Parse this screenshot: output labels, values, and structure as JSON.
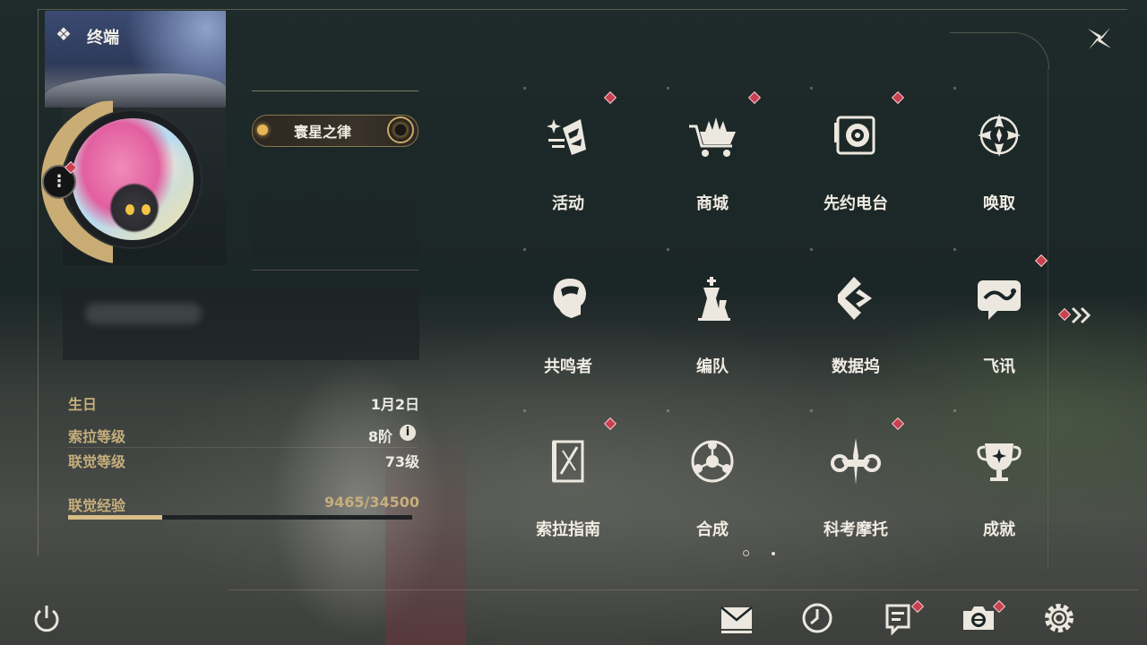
{
  "header": {
    "title": "终端"
  },
  "profile": {
    "title_badge": "寰星之律",
    "stats": [
      {
        "label": "生日",
        "value": "1月2日"
      },
      {
        "label": "索拉等级",
        "value": "8阶"
      },
      {
        "label": "联觉等级",
        "value": "73级"
      }
    ],
    "experience": {
      "label": "联觉经验",
      "value": "9465/34500",
      "current": 9465,
      "max": 34500
    }
  },
  "menu": {
    "items": [
      {
        "label": "活动",
        "icon": "activity-icon",
        "badge": true
      },
      {
        "label": "商城",
        "icon": "shop-cart-icon",
        "badge": true
      },
      {
        "label": "先约电台",
        "icon": "radio-icon",
        "badge": true
      },
      {
        "label": "唤取",
        "icon": "compass-star-icon",
        "badge": false
      },
      {
        "label": "共鸣者",
        "icon": "resonator-head-icon",
        "badge": false
      },
      {
        "label": "编队",
        "icon": "chess-team-icon",
        "badge": false
      },
      {
        "label": "数据坞",
        "icon": "data-dock-icon",
        "badge": false
      },
      {
        "label": "飞讯",
        "icon": "chat-icon",
        "badge": true
      },
      {
        "label": "索拉指南",
        "icon": "guide-book-icon",
        "badge": true
      },
      {
        "label": "合成",
        "icon": "synthesis-icon",
        "badge": false
      },
      {
        "label": "科考摩托",
        "icon": "motorcycle-icon",
        "badge": true
      },
      {
        "label": "成就",
        "icon": "trophy-icon",
        "badge": false
      }
    ],
    "pages": 2,
    "current_page": 1
  },
  "bottom_bar": {
    "icons": [
      "mail-icon",
      "clock-icon",
      "notice-icon",
      "camera-icon",
      "settings-gear-icon"
    ],
    "badges": {
      "notice-icon": true,
      "camera-icon": true
    }
  },
  "colors": {
    "accent_gold": "#c6ae7c",
    "badge_red": "#c9404f",
    "text_light": "#ecebe4"
  }
}
